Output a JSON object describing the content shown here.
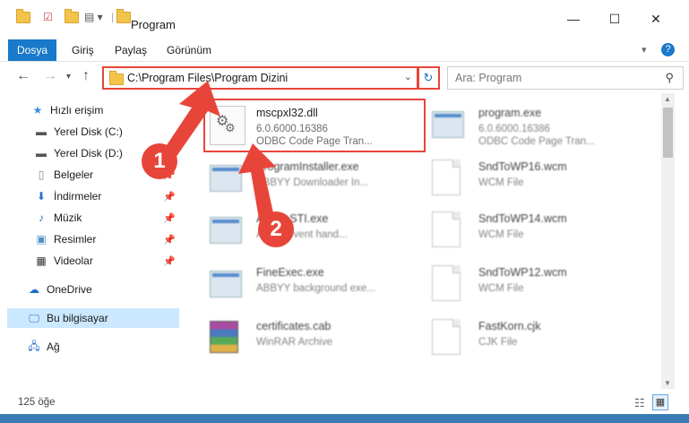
{
  "window": {
    "title": "Program",
    "minimize": "—",
    "maximize": "☐",
    "close": "✕"
  },
  "ribbon": {
    "tabs": [
      "Dosya",
      "Giriş",
      "Paylaş",
      "Görünüm"
    ],
    "help": "?"
  },
  "nav": {
    "address": "C:\\Program Files\\Program Dizini",
    "search_placeholder": "Ara: Program"
  },
  "sidebar": {
    "items": [
      {
        "label": "Hızlı erişim",
        "icon": "star-icon"
      },
      {
        "label": "Yerel Disk (C:)",
        "icon": "drive-icon"
      },
      {
        "label": "Yerel Disk (D:)",
        "icon": "drive-icon"
      },
      {
        "label": "Belgeler",
        "icon": "documents-icon"
      },
      {
        "label": "İndirmeler",
        "icon": "download-icon"
      },
      {
        "label": "Müzik",
        "icon": "music-icon"
      },
      {
        "label": "Resimler",
        "icon": "pictures-icon"
      },
      {
        "label": "Videolar",
        "icon": "videos-icon"
      },
      {
        "label": "OneDrive",
        "icon": "cloud-icon"
      },
      {
        "label": "Bu bilgisayar",
        "icon": "computer-icon"
      },
      {
        "label": "Ağ",
        "icon": "network-icon"
      }
    ]
  },
  "files": [
    {
      "name": "mscpxl32.dll",
      "line1": "6.0.6000.16386",
      "line2": "ODBC Code Page Tran...",
      "icon": "dll-gear-icon"
    },
    {
      "name": "program.exe",
      "line1": "6.0.6000.16386",
      "line2": "ODBC Code Page Tran...",
      "icon": "exe-icon"
    },
    {
      "name": "ProgramInstaller.exe",
      "line1": "ABBYY Downloader In...",
      "line2": "",
      "icon": "window-icon"
    },
    {
      "name": "SndToWP16.wcm",
      "line1": "WCM File",
      "line2": "",
      "icon": "document-icon"
    },
    {
      "name": "Abbyy.STI.exe",
      "line1": "Abbyy event hand...",
      "line2": "",
      "icon": "window-icon"
    },
    {
      "name": "SndToWP14.wcm",
      "line1": "WCM File",
      "line2": "",
      "icon": "document-icon"
    },
    {
      "name": "FineExec.exe",
      "line1": "ABBYY background exe...",
      "line2": "",
      "icon": "window-icon"
    },
    {
      "name": "SndToWP12.wcm",
      "line1": "WCM File",
      "line2": "",
      "icon": "document-icon"
    },
    {
      "name": "certificates.cab",
      "line1": "WinRAR Archive",
      "line2": "",
      "icon": "archive-icon"
    },
    {
      "name": "FastKorn.cjk",
      "line1": "CJK File",
      "line2": "",
      "icon": "document-icon"
    }
  ],
  "status": {
    "count": "125 öğe"
  },
  "callouts": [
    "1",
    "2"
  ],
  "colors": {
    "accent": "#1979ca",
    "highlight": "#e8453a",
    "selected": "#cce8ff"
  }
}
